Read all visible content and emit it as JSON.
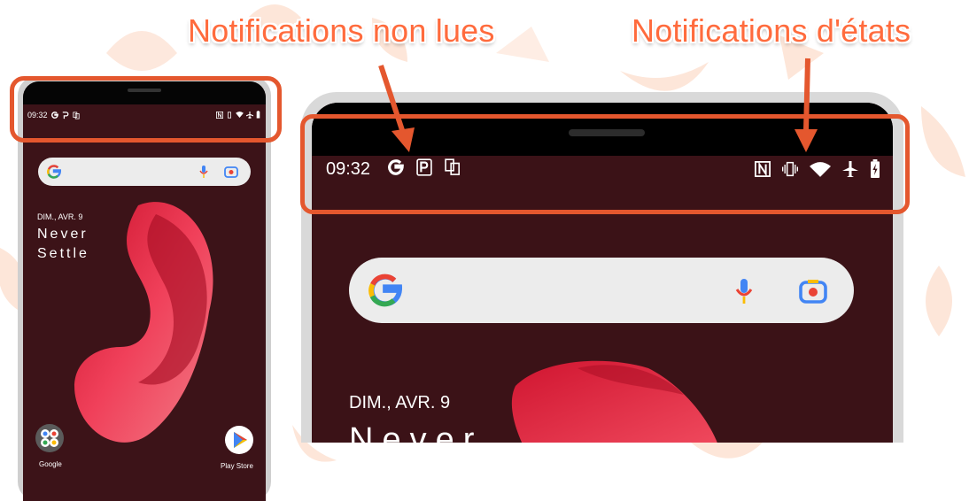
{
  "annotations": {
    "unread_label": "Notifications non lues",
    "status_label": "Notifications d'états",
    "accent_color": "#e4572e"
  },
  "phone_small": {
    "status_bar": {
      "time": "09:32",
      "notification_icons": [
        "google-icon",
        "parking-icon",
        "dual-screen-icon"
      ],
      "status_icons": [
        "nfc-icon",
        "vibrate-icon",
        "wifi-icon",
        "airplane-icon",
        "battery-icon"
      ]
    },
    "date": "DIM., AVR. 9",
    "slogan_line1": "Never",
    "slogan_line2": "Settle",
    "apps": [
      {
        "label": "Google",
        "icon": "google-folder-icon"
      },
      {
        "label": "Play Store",
        "icon": "play-store-icon"
      }
    ]
  },
  "phone_big": {
    "status_bar": {
      "time": "09:32",
      "notification_icons": [
        "google-icon",
        "parking-icon",
        "dual-screen-icon"
      ],
      "status_icons": [
        "nfc-icon",
        "vibrate-icon",
        "wifi-icon",
        "airplane-icon",
        "battery-icon"
      ]
    },
    "date": "DIM., AVR. 9",
    "slogan": "Never"
  },
  "colors": {
    "wallpaper": "#3b1217",
    "petal": "#e8344a",
    "search_bg": "#ececec"
  }
}
